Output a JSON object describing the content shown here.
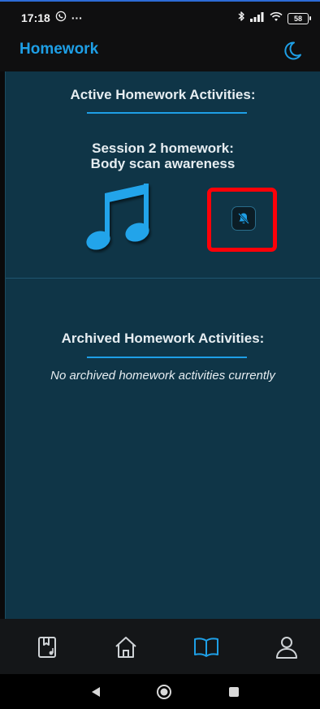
{
  "status_bar": {
    "time": "17:18",
    "more": "···",
    "battery": "58"
  },
  "header": {
    "title": "Homework"
  },
  "active_section": {
    "heading": "Active Homework Activities:",
    "session_line1": "Session 2 homework:",
    "session_line2": "Body scan awareness"
  },
  "archived_section": {
    "heading": "Archived Homework Activities:",
    "empty_message": "No archived homework activities currently"
  },
  "colors": {
    "accent": "#1e9fe6",
    "content_bg": "#0f3547",
    "highlight": "#ff0008"
  },
  "icons": {
    "status": [
      "whatsapp-icon",
      "bluetooth-icon",
      "signal-icon",
      "wifi-icon",
      "battery-icon"
    ],
    "header": "moon-icon",
    "activity": [
      "music-note-icon",
      "bell-off-icon"
    ],
    "nav": [
      "book-bookmark-icon",
      "home-icon",
      "open-book-icon",
      "profile-icon"
    ],
    "system": [
      "back-icon",
      "home-circle-icon",
      "recents-icon"
    ]
  }
}
